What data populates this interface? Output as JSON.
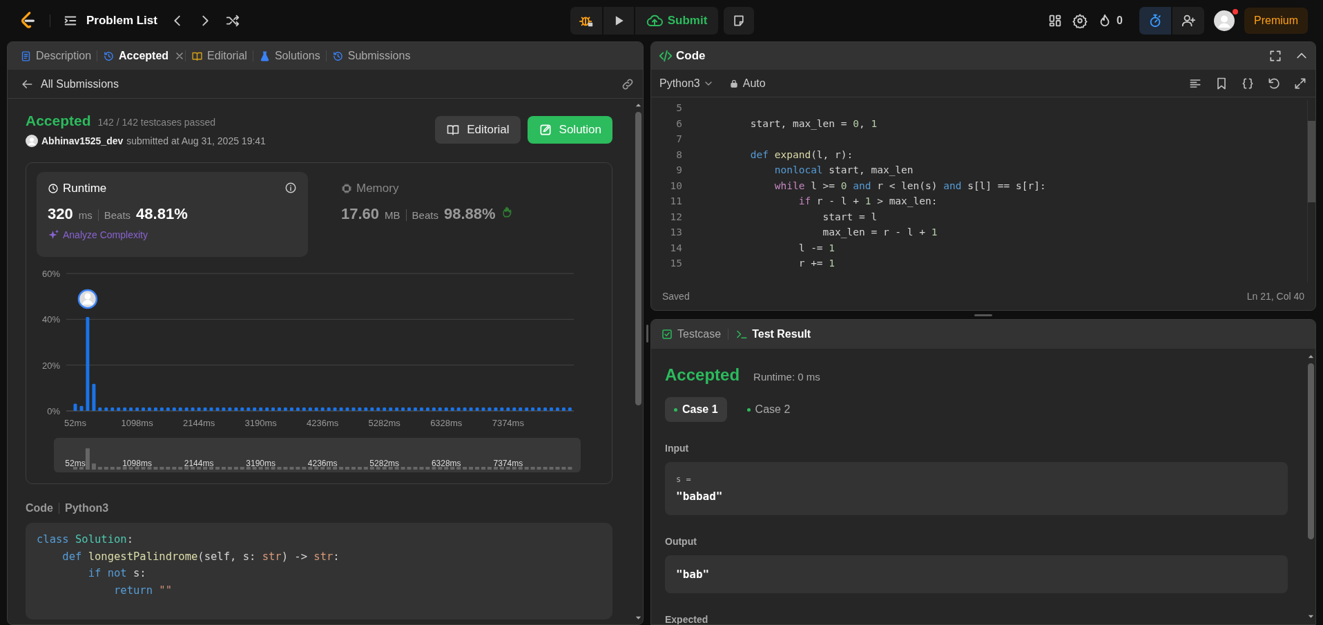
{
  "top_bar": {
    "title": "Problem List",
    "submit_label": "Submit",
    "streak": "0",
    "timer_active": true,
    "notification": true,
    "premium_label": "Premium"
  },
  "left_panel": {
    "tabs": [
      {
        "label": "Description",
        "selected": false,
        "closable": false
      },
      {
        "label": "Accepted",
        "selected": true,
        "closable": true
      },
      {
        "label": "Editorial",
        "selected": false,
        "closable": false
      },
      {
        "label": "Solutions",
        "selected": false,
        "closable": false
      },
      {
        "label": "Submissions",
        "selected": false,
        "closable": false
      }
    ],
    "back_label": "All Submissions",
    "submission": {
      "status": "Accepted",
      "testcases": "142 / 142 testcases passed",
      "user": "Abhinav1525_dev",
      "submitted": "submitted at Aug 31, 2025 19:41",
      "buttons": [
        "Editorial",
        "Solution"
      ]
    },
    "stats": [
      {
        "title": "Runtime",
        "value": "320",
        "unit": "ms",
        "beats_label": "Beats",
        "beats": "48.81%",
        "link": "Analyze Complexity",
        "selected": true
      },
      {
        "title": "Memory",
        "value": "17.60",
        "unit": "MB",
        "beats_label": "Beats",
        "beats": "98.88%",
        "selected": false
      }
    ],
    "chart_data": {
      "type": "bar",
      "x": [
        52,
        157,
        261,
        366,
        470,
        575,
        680,
        784,
        889,
        993,
        1098,
        1203,
        1307,
        1412,
        1516,
        1621,
        1726,
        1830,
        1935,
        2039,
        2144,
        2249,
        2353,
        2458,
        2562,
        2667,
        2772,
        2876,
        2981,
        3085,
        3190,
        3295,
        3399,
        3504,
        3608,
        3713,
        3818,
        3922,
        4027,
        4131,
        4236,
        4341,
        4445,
        4550,
        4654,
        4759,
        4864,
        4968,
        5073,
        5177,
        5282,
        5387,
        5491,
        5596,
        5700,
        5805,
        5910,
        6014,
        6119,
        6223,
        6328,
        6433,
        6537,
        6642,
        6746,
        6851,
        6956,
        7060,
        7165,
        7269,
        7374,
        7479,
        7583,
        7688,
        7792,
        7897,
        8002,
        8106,
        8211,
        8315,
        8420
      ],
      "values": [
        3.2,
        2.2,
        41,
        11.8,
        1.5,
        1.5,
        1.5,
        1.5,
        1.5,
        1.5,
        1.5,
        1.5,
        1.5,
        1.5,
        1.5,
        1.5,
        1.5,
        1.5,
        1.5,
        1.5,
        1.5,
        1.5,
        1.5,
        1.5,
        1.5,
        1.5,
        1.5,
        1.5,
        1.5,
        1.5,
        1.5,
        1.5,
        1.5,
        1.5,
        1.5,
        1.5,
        1.5,
        1.5,
        1.5,
        1.5,
        1.5,
        1.5,
        1.5,
        1.5,
        1.5,
        1.5,
        1.5,
        1.5,
        1.5,
        1.5,
        1.5,
        1.5,
        1.5,
        1.5,
        1.5,
        1.5,
        1.5,
        1.5,
        1.5,
        1.5,
        1.5,
        1.5,
        1.5,
        1.5,
        1.5,
        1.5,
        1.5,
        1.5,
        1.5,
        1.5,
        1.5,
        1.5,
        1.5,
        1.5,
        1.5,
        1.5,
        1.5,
        1.5,
        1.5,
        1.5,
        1.5
      ],
      "xlim": [
        -100,
        8486
      ],
      "xticks": [
        {
          "value": 52,
          "label": "52ms"
        },
        {
          "value": 1098,
          "label": "1098ms"
        },
        {
          "value": 2144,
          "label": "2144ms"
        },
        {
          "value": 3190,
          "label": "3190ms"
        },
        {
          "value": 4236,
          "label": "4236ms"
        },
        {
          "value": 5282,
          "label": "5282ms"
        },
        {
          "value": 6328,
          "label": "6328ms"
        },
        {
          "value": 7374,
          "label": "7374ms"
        }
      ],
      "yticks": [
        {
          "value": 0,
          "label": "0%"
        },
        {
          "value": 20,
          "label": "20%"
        },
        {
          "value": 40,
          "label": "40%"
        },
        {
          "value": 60,
          "label": "60%"
        }
      ],
      "ylim": [
        0,
        60
      ]
    },
    "navigator": {
      "tick_labels": [
        "52ms",
        "1098ms",
        "2144ms",
        "3190ms",
        "4236ms",
        "5282ms",
        "6328ms",
        "7374ms"
      ]
    },
    "code_header": {
      "label": "Code",
      "language": "Python3"
    },
    "code_lines": [
      {
        "tokens": [
          {
            "text": "class",
            "kind": "keyword"
          },
          {
            "text": " Solution",
            "kind": "class"
          },
          {
            "text": ":",
            "kind": "plain"
          }
        ]
      },
      {
        "tokens": [
          {
            "text": "    def",
            "kind": "keyword"
          },
          {
            "text": " longestPalindrome",
            "kind": "func"
          },
          {
            "text": "(self, s: ",
            "kind": "plain"
          },
          {
            "text": "str",
            "kind": "type"
          },
          {
            "text": ") -> ",
            "kind": "plain"
          },
          {
            "text": "str",
            "kind": "type"
          },
          {
            "text": ":",
            "kind": "plain"
          }
        ]
      },
      {
        "tokens": [
          {
            "text": "        if not",
            "kind": "keyword"
          },
          {
            "text": " s:",
            "kind": "plain"
          }
        ]
      },
      {
        "tokens": [
          {
            "text": "            return",
            "kind": "keyword"
          },
          {
            "text": " \"\"",
            "kind": "string"
          }
        ]
      }
    ]
  },
  "code_panel": {
    "title": "Code",
    "language": "Python3",
    "mode": "Auto",
    "lines": [
      {
        "number": "5"
      },
      {
        "number": "6",
        "tokens": [
          {
            "text": "        start, max_len = ",
            "kind": "plain"
          },
          {
            "text": "0",
            "kind": "number"
          },
          {
            "text": ", ",
            "kind": "plain"
          },
          {
            "text": "1",
            "kind": "number"
          }
        ]
      },
      {
        "number": "7"
      },
      {
        "number": "8",
        "tokens": [
          {
            "text": "        def",
            "kind": "keyword"
          },
          {
            "text": " expand",
            "kind": "func"
          },
          {
            "text": "(l, r):",
            "kind": "plain"
          }
        ]
      },
      {
        "number": "9",
        "tokens": [
          {
            "text": "            nonlocal",
            "kind": "keyword"
          },
          {
            "text": " start, max_len",
            "kind": "plain"
          }
        ]
      },
      {
        "number": "10",
        "tokens": [
          {
            "text": "            while",
            "kind": "control"
          },
          {
            "text": " l >= ",
            "kind": "plain"
          },
          {
            "text": "0",
            "kind": "number"
          },
          {
            "text": " and",
            "kind": "keyword"
          },
          {
            "text": " r < len(s) ",
            "kind": "plain"
          },
          {
            "text": "and",
            "kind": "keyword"
          },
          {
            "text": " s[l] == s[r]:",
            "kind": "plain"
          }
        ]
      },
      {
        "number": "11",
        "tokens": [
          {
            "text": "                if",
            "kind": "control"
          },
          {
            "text": " r - l + ",
            "kind": "plain"
          },
          {
            "text": "1",
            "kind": "number"
          },
          {
            "text": " > max_len:",
            "kind": "plain"
          }
        ]
      },
      {
        "number": "12",
        "tokens": [
          {
            "text": "                    start = l",
            "kind": "plain"
          }
        ]
      },
      {
        "number": "13",
        "tokens": [
          {
            "text": "                    max_len = r - l + ",
            "kind": "plain"
          },
          {
            "text": "1",
            "kind": "number"
          }
        ]
      },
      {
        "number": "14",
        "tokens": [
          {
            "text": "                l -= ",
            "kind": "plain"
          },
          {
            "text": "1",
            "kind": "number"
          }
        ]
      },
      {
        "number": "15",
        "tokens": [
          {
            "text": "                r += ",
            "kind": "plain"
          },
          {
            "text": "1",
            "kind": "number"
          }
        ]
      }
    ],
    "status": "Saved",
    "cursor": "Ln 21, Col 40"
  },
  "test_panel": {
    "tabs": [
      {
        "label": "Testcase",
        "selected": false
      },
      {
        "label": "Test Result",
        "selected": true
      }
    ],
    "status": "Accepted",
    "runtime": "Runtime: 0 ms",
    "cases": [
      {
        "label": "Case 1",
        "selected": true,
        "passed": true
      },
      {
        "label": "Case 2",
        "selected": false,
        "passed": true
      }
    ],
    "input_label": "Input",
    "inputs": [
      {
        "name": "s =",
        "value": "\"babad\""
      }
    ],
    "output_label": "Output",
    "output": "\"bab\"",
    "expected_label": "Expected"
  }
}
